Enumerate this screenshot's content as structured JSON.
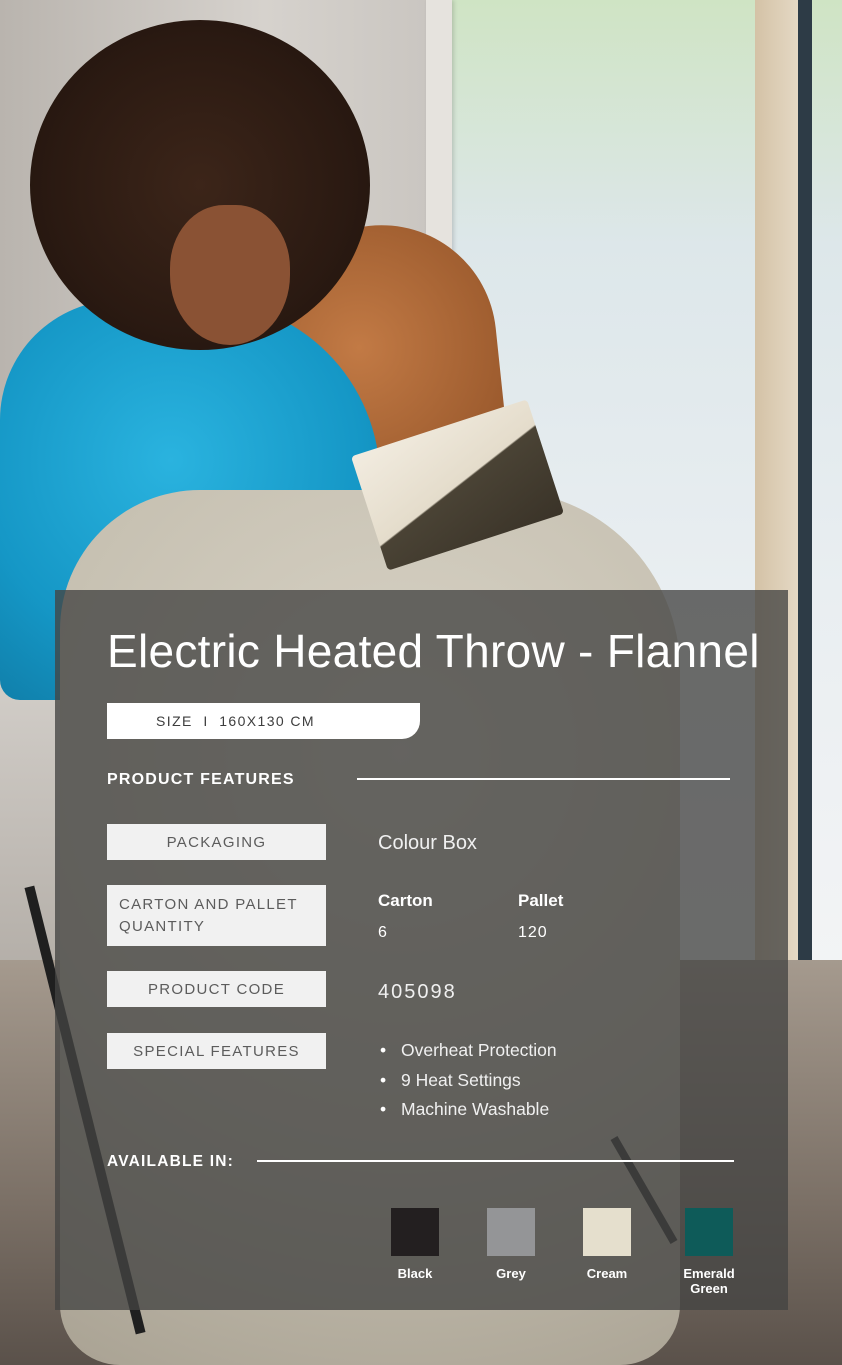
{
  "title": "Electric Heated Throw - Flannel",
  "size": "SIZE  I  160X130 CM",
  "features_heading": "PRODUCT FEATURES",
  "packaging": {
    "label": "PACKAGING",
    "value": "Colour Box"
  },
  "quantity": {
    "label": "CARTON AND PALLET QUANTITY",
    "carton_label": "Carton",
    "carton_value": "6",
    "pallet_label": "Pallet",
    "pallet_value": "120"
  },
  "product_code": {
    "label": "PRODUCT CODE",
    "value": "405098"
  },
  "special_features": {
    "label": "SPECIAL FEATURES",
    "items": [
      "Overheat Protection",
      "9 Heat Settings",
      "Machine Washable"
    ]
  },
  "available_heading": "AVAILABLE IN:",
  "colours": [
    {
      "name": "Black",
      "hex": "#231f20"
    },
    {
      "name": "Grey",
      "hex": "#949597"
    },
    {
      "name": "Cream",
      "hex": "#e5dfcd"
    },
    {
      "name": "Emerald Green",
      "hex": "#0e5b59"
    }
  ]
}
